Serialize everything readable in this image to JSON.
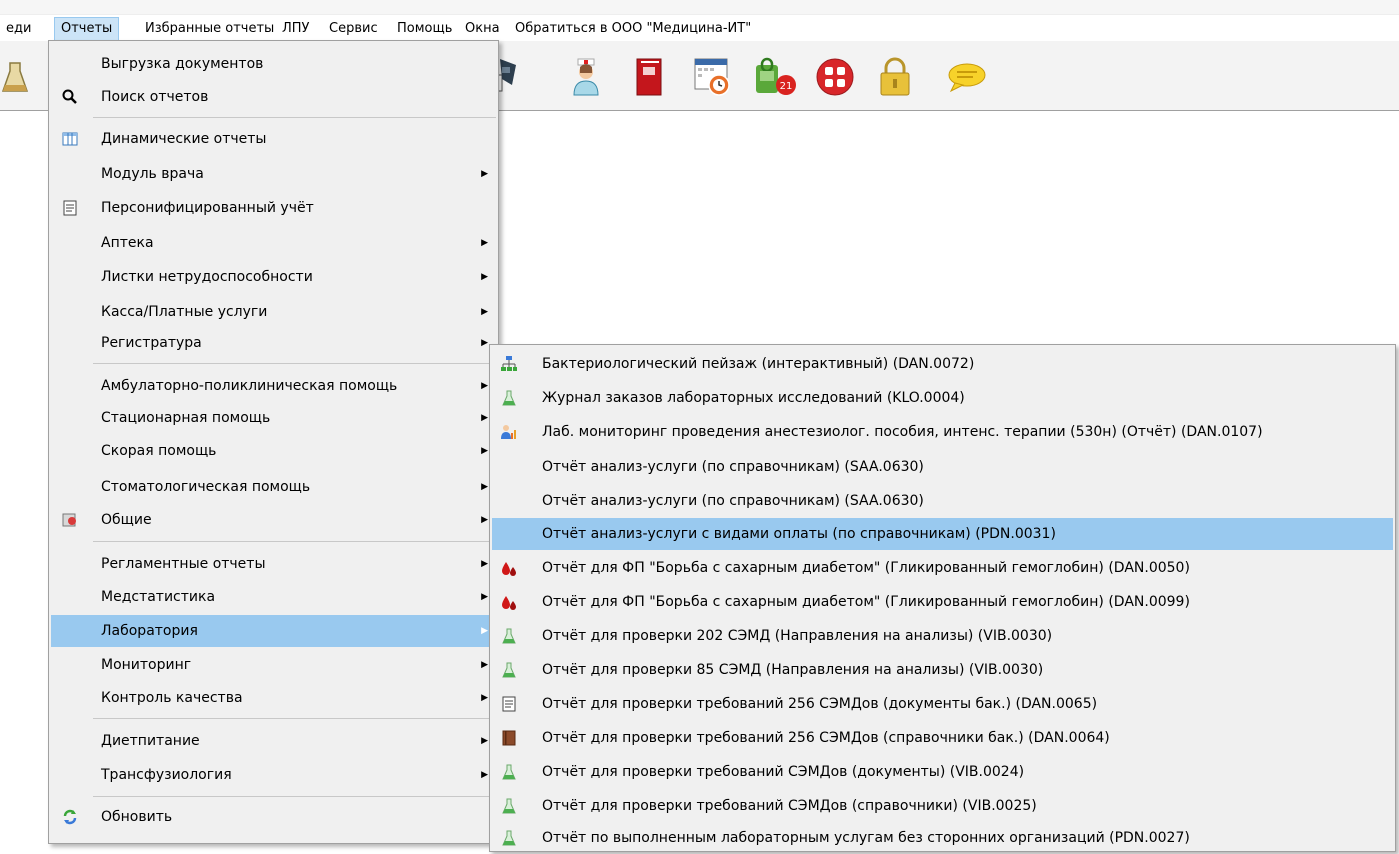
{
  "menubar": {
    "items": [
      "еди",
      "Отчеты",
      "Избранные отчеты",
      "ЛПУ",
      "Сервис",
      "Помощь",
      "Окна",
      "Обратиться в ООО \"Медицина-ИТ\""
    ]
  },
  "toolbar": {
    "icons": [
      "flask-icon",
      "barcode-scanner-icon",
      "nurse-icon",
      "red-book-icon",
      "calendar-clock-icon",
      "lock-calendar-21-icon",
      "apps-grid-icon",
      "padlock-icon",
      "chat-bubble-icon"
    ],
    "badge_number": "21"
  },
  "main_menu": {
    "items": [
      {
        "label": "Выгрузка документов",
        "icon": "",
        "submenu": false
      },
      {
        "label": "Поиск отчетов",
        "icon": "search-icon",
        "submenu": false
      },
      {
        "label": "Динамические отчеты",
        "icon": "table-icon",
        "submenu": false
      },
      {
        "label": "Модуль врача",
        "icon": "",
        "submenu": true
      },
      {
        "label": "Персонифицированный учёт",
        "icon": "document-icon",
        "submenu": false
      },
      {
        "label": "Аптека",
        "icon": "",
        "submenu": true
      },
      {
        "label": "Листки нетрудоспособности",
        "icon": "",
        "submenu": true
      },
      {
        "label": "Касса/Платные услуги",
        "icon": "",
        "submenu": true
      },
      {
        "label": "Регистратура",
        "icon": "",
        "submenu": true
      },
      {
        "label": "Амбулаторно-поликлиническая помощь",
        "icon": "",
        "submenu": true
      },
      {
        "label": "Стационарная помощь",
        "icon": "",
        "submenu": true
      },
      {
        "label": "Скорая помощь",
        "icon": "",
        "submenu": true
      },
      {
        "label": "Стоматологическая помощь",
        "icon": "",
        "submenu": true
      },
      {
        "label": "Общие",
        "icon": "general-icon",
        "submenu": true
      },
      {
        "label": "Регламентные отчеты",
        "icon": "",
        "submenu": true
      },
      {
        "label": "Медстатистика",
        "icon": "",
        "submenu": true
      },
      {
        "label": "Лаборатория",
        "icon": "",
        "submenu": true,
        "highlighted": true
      },
      {
        "label": "Мониторинг",
        "icon": "",
        "submenu": true
      },
      {
        "label": "Контроль качества",
        "icon": "",
        "submenu": true
      },
      {
        "label": "Диетпитание",
        "icon": "",
        "submenu": true
      },
      {
        "label": "Трансфузиология",
        "icon": "",
        "submenu": true
      },
      {
        "label": "Обновить",
        "icon": "refresh-icon",
        "submenu": false
      }
    ]
  },
  "sub_menu": {
    "items": [
      {
        "label": "Бактериологический пейзаж (интерактивный) (DAN.0072)",
        "icon": "hierarchy-icon"
      },
      {
        "label": "Журнал заказов лабораторных исследований (KLO.0004)",
        "icon": "flask-icon"
      },
      {
        "label": "Лаб. мониторинг проведения анестезиолог. пособия, интенс. терапии (530н) (Отчёт) (DAN.0107)",
        "icon": "doctor-chart-icon"
      },
      {
        "label": "Отчёт анализ-услуги (по справочникам) (SAA.0630)",
        "icon": ""
      },
      {
        "label": "Отчёт анализ-услуги (по справочникам) (SAA.0630)",
        "icon": ""
      },
      {
        "label": "Отчёт анализ-услуги с видами оплаты (по справочникам) (PDN.0031)",
        "icon": "",
        "highlighted": true
      },
      {
        "label": "Отчёт для ФП \"Борьба с сахарным диабетом\" (Гликированный гемоглобин) (DAN.0050)",
        "icon": "blood-drop-icon"
      },
      {
        "label": "Отчёт для ФП \"Борьба с сахарным диабетом\" (Гликированный гемоглобин) (DAN.0099)",
        "icon": "blood-drop-icon"
      },
      {
        "label": "Отчёт для проверки 202 СЭМД (Направления на анализы) (VIB.0030)",
        "icon": "flask-icon"
      },
      {
        "label": "Отчёт для проверки 85 СЭМД (Направления на анализы) (VIB.0030)",
        "icon": "flask-icon"
      },
      {
        "label": "Отчёт для проверки требований 256 СЭМДов (документы бак.) (DAN.0065)",
        "icon": "document-icon"
      },
      {
        "label": "Отчёт для проверки требований 256 СЭМДов (справочники бак.) (DAN.0064)",
        "icon": "book-icon"
      },
      {
        "label": "Отчёт для проверки требований СЭМДов (документы) (VIB.0024)",
        "icon": "flask-icon"
      },
      {
        "label": "Отчёт для проверки требований СЭМДов (справочники) (VIB.0025)",
        "icon": "flask-icon"
      },
      {
        "label": "Отчёт по выполненным лабораторным услугам без сторонних организаций (PDN.0027)",
        "icon": "flask-icon"
      }
    ]
  },
  "colors": {
    "highlight": "#99c9ef",
    "menu_bg": "#f0f0f0",
    "menubar_active": "#cce4f7"
  }
}
